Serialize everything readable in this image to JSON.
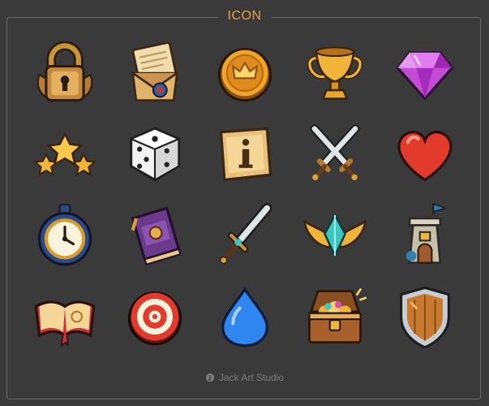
{
  "header": {
    "title": "ICON"
  },
  "footer": {
    "credit": "Jack Art Studio"
  },
  "icons": [
    "padlock-icon",
    "scroll-letter-icon",
    "crown-coin-icon",
    "trophy-icon",
    "gem-icon",
    "stars-icon",
    "dice-icon",
    "info-parchment-icon",
    "crossed-swords-icon",
    "heart-icon",
    "stopwatch-icon",
    "spell-book-icon",
    "sword-icon",
    "winged-crystal-icon",
    "tower-icon",
    "open-book-icon",
    "target-icon",
    "water-drop-icon",
    "treasure-chest-icon",
    "shield-icon"
  ],
  "colors": {
    "background": "#3a3a3a",
    "title": "#e4a04a",
    "gold": "#f0b43a",
    "gem": "#c34bd6",
    "heart": "#e23a2c",
    "drop": "#2f86f0"
  }
}
